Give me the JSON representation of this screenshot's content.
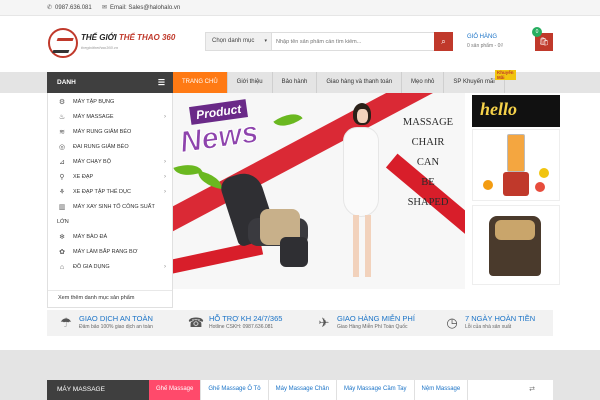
{
  "topbar": {
    "phone": "0987.636.081",
    "email": "Email: Sales@halohalo.vn"
  },
  "header": {
    "logo_name_1": "THẾ GIỚI",
    "logo_name_2": "THỂ THAO 360",
    "logo_tagline": "thegioithethao360.vn"
  },
  "search": {
    "category": "Chọn danh mục",
    "placeholder": "Nhập tên sản phẩm cần tìm kiếm..."
  },
  "cart": {
    "title": "GIỎ HÀNG",
    "summary": "0 sản phẩm - 0₫",
    "count": "0"
  },
  "menu": {
    "title": "DANH",
    "items": [
      {
        "label": "MÁY TẬP BỤNG",
        "icon": "ab-trainer-icon",
        "has_sub": false
      },
      {
        "label": "MÁY MASSAGE",
        "icon": "massage-icon",
        "has_sub": true
      },
      {
        "label": "MÁY RUNG GIẢM BÉO",
        "icon": "vibration-icon",
        "has_sub": false
      },
      {
        "label": "ĐAI RUNG GIẢM BÉO",
        "icon": "belt-icon",
        "has_sub": false
      },
      {
        "label": "MÁY CHẠY BỘ",
        "icon": "treadmill-icon",
        "has_sub": true
      },
      {
        "label": "XE ĐẠP",
        "icon": "bicycle-icon",
        "has_sub": true
      },
      {
        "label": "XE ĐẠP TẬP THỂ DỤC",
        "icon": "exercise-bike-icon",
        "has_sub": true
      },
      {
        "label": "MÁY XAY SINH TỐ CÔNG SUẤT",
        "icon": "blender-icon",
        "has_sub": false
      },
      {
        "label": "LỚN",
        "icon": "",
        "has_sub": false
      },
      {
        "label": "MÁY BÀO ĐÁ",
        "icon": "ice-shaver-icon",
        "has_sub": false
      },
      {
        "label": "MÁY LÀM BẮP RANG BƠ",
        "icon": "popcorn-icon",
        "has_sub": false
      },
      {
        "label": "ĐỒ GIA DỤNG",
        "icon": "household-icon",
        "has_sub": true
      }
    ],
    "more": "Xem thêm danh mục sản phẩm"
  },
  "nav": {
    "items": [
      "TRANG CHỦ",
      "Giới thiệu",
      "Bảo hành",
      "Giao hàng và thanh toán",
      "Mẹo nhỏ",
      "SP Khuyến mãi"
    ],
    "active_index": 0,
    "hot_label": "Khuyến Mãi"
  },
  "banner": {
    "badge_top": "Product",
    "badge_bottom": "News",
    "caption_lines": [
      "MASSAGE",
      "CHAIR",
      "CAN",
      "BE",
      "SHAPED"
    ]
  },
  "side_promo": {
    "hello_text": "hello"
  },
  "benefits": [
    {
      "title": "GIAO DỊCH AN TOÀN",
      "sub": "Đảm bảo 100% giao dịch an toàn",
      "icon": "umbrella-icon"
    },
    {
      "title": "HỖ TRỢ KH 24/7/365",
      "sub": "Hotline CSKH: 0987.636.081",
      "icon": "support-icon"
    },
    {
      "title": "GIAO HÀNG MIỄN PHÍ",
      "sub": "Giao Hàng Miễn Phí Toàn Quốc",
      "icon": "airplane-icon"
    },
    {
      "title": "7 NGÀY HOÀN TIỀN",
      "sub": "Lỗi của nhà sản xuất",
      "icon": "clock-icon"
    }
  ],
  "section": {
    "title": "MÁY MASSAGE",
    "tabs": [
      "Ghế Massage",
      "Ghế Massage Ô Tô",
      "Máy Massage Chân",
      "Máy Massage Cầm Tay",
      "Nệm Massage"
    ],
    "active_tab": 0
  },
  "colors": {
    "brand_red": "#c0392b",
    "nav_active": "#ff7a14",
    "link_blue": "#1a73c7",
    "tab_active": "#ff4a6b",
    "dark_bar": "#3f3f3f"
  }
}
